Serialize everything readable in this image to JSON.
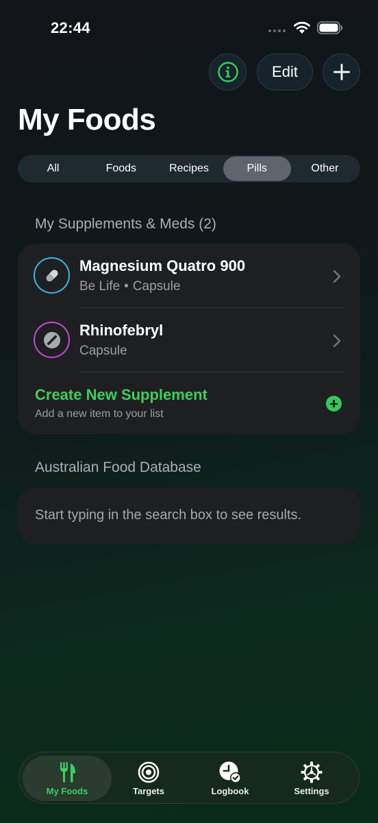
{
  "status_bar": {
    "time": "22:44"
  },
  "header": {
    "info_icon": "info-circle-icon",
    "edit_label": "Edit",
    "add_icon": "plus-icon",
    "title": "My Foods"
  },
  "filter_tabs": [
    {
      "label": "All",
      "active": false
    },
    {
      "label": "Foods",
      "active": false
    },
    {
      "label": "Recipes",
      "active": false
    },
    {
      "label": "Pills",
      "active": true
    },
    {
      "label": "Other",
      "active": false
    }
  ],
  "supplements": {
    "header": "My Supplements & Meds (2)",
    "items": [
      {
        "name": "Magnesium Quatro 900",
        "brand": "Be Life",
        "form": "Capsule",
        "icon": "capsule-icon",
        "ring_color": "#3bb7e8"
      },
      {
        "name": "Rhinofebryl",
        "form": "Capsule",
        "icon": "tablet-icon",
        "ring_color": "#c74ad8"
      }
    ],
    "create": {
      "title": "Create New Supplement",
      "subtitle": "Add a new item to your list",
      "accent": "#3ccf5e"
    }
  },
  "database": {
    "header": "Australian Food Database",
    "empty_message": "Start typing in the search box to see results."
  },
  "tab_bar": [
    {
      "label": "My Foods",
      "icon": "fork-knife-icon",
      "active": true
    },
    {
      "label": "Targets",
      "icon": "target-icon",
      "active": false
    },
    {
      "label": "Logbook",
      "icon": "clock-check-icon",
      "active": false
    },
    {
      "label": "Settings",
      "icon": "gear-icon",
      "active": false
    }
  ]
}
